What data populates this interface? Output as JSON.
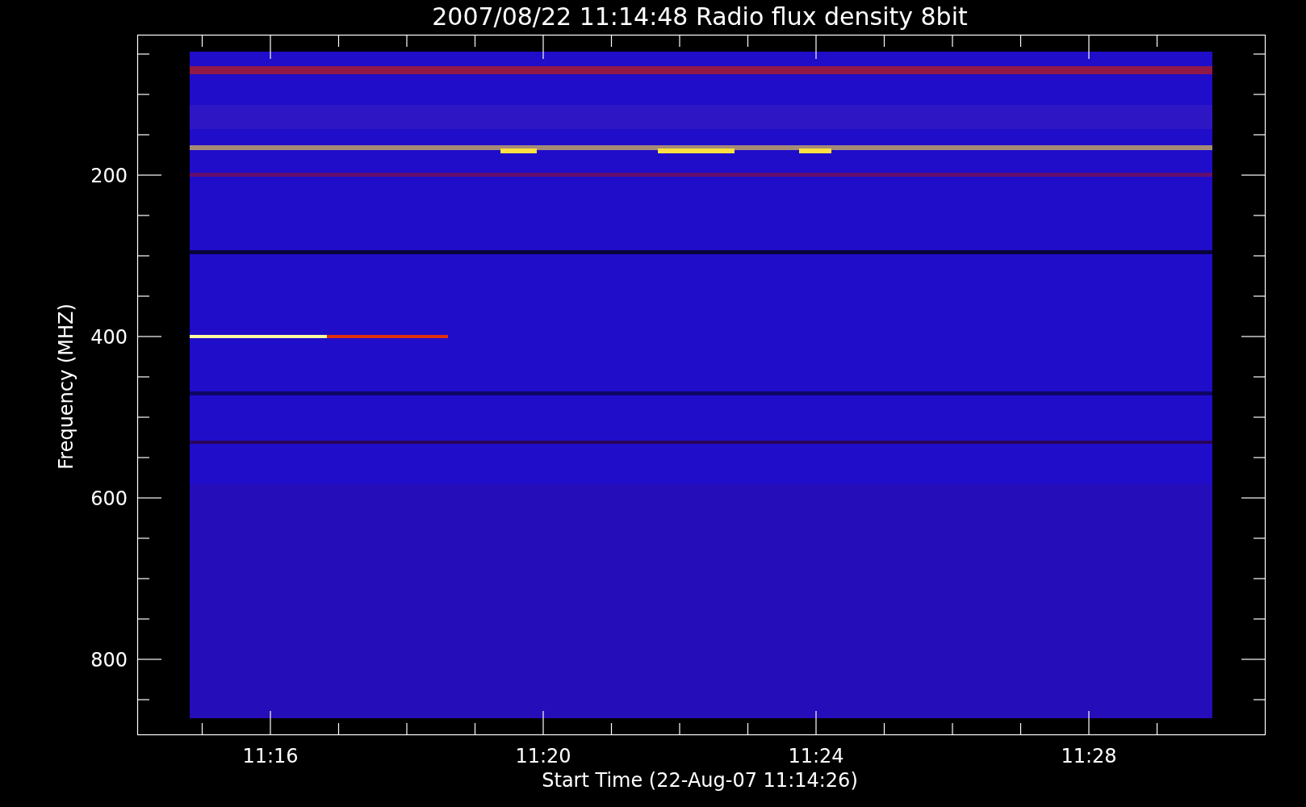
{
  "title": "2007/08/22 11:14:48 Radio flux density 8bit",
  "y_axis": {
    "label": "Frequency (MHZ)",
    "tick_labels": [
      "200",
      "400",
      "600",
      "800"
    ]
  },
  "x_axis": {
    "label": "Start Time (22-Aug-07 11:14:26)",
    "tick_labels": [
      "11:16",
      "11:20",
      "11:24",
      "11:28"
    ]
  }
}
